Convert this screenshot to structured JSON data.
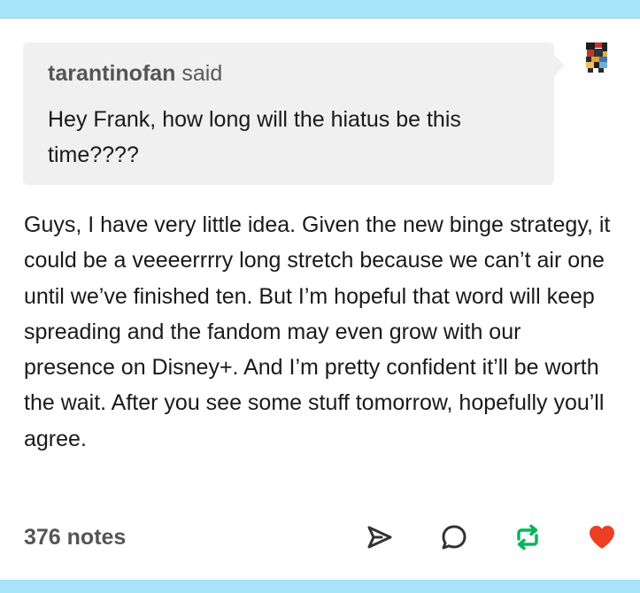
{
  "post": {
    "asker": "tarantinofan",
    "asker_said": "said",
    "question": "Hey Frank, how long will the hiatus be this time????",
    "answer": "Guys, I have very little idea. Given the new binge strategy, it could be a veeeerrrry long stretch because we can’t air one until we’ve finished ten. But I’m hopeful that word will keep spreading and the fandom may even grow with our presence on Disney+. And I’m pretty confident it’ll be worth the wait. After you see some stuff tomorrow, hopefully you’ll agree."
  },
  "footer": {
    "notes": "376 notes",
    "actions": [
      {
        "name": "share",
        "icon": "paper-plane-icon",
        "color": "#333333"
      },
      {
        "name": "reply",
        "icon": "speech-bubble-icon",
        "color": "#333333"
      },
      {
        "name": "reblog",
        "icon": "reblog-icon",
        "color": "#00b85c"
      },
      {
        "name": "like",
        "icon": "heart-icon",
        "color": "#ec3f22"
      }
    ]
  },
  "colors": {
    "bar": "#a6e4f9",
    "bubble": "#f0f0f0",
    "reblog_green": "#00b85c",
    "heart_red": "#ec3f22"
  }
}
